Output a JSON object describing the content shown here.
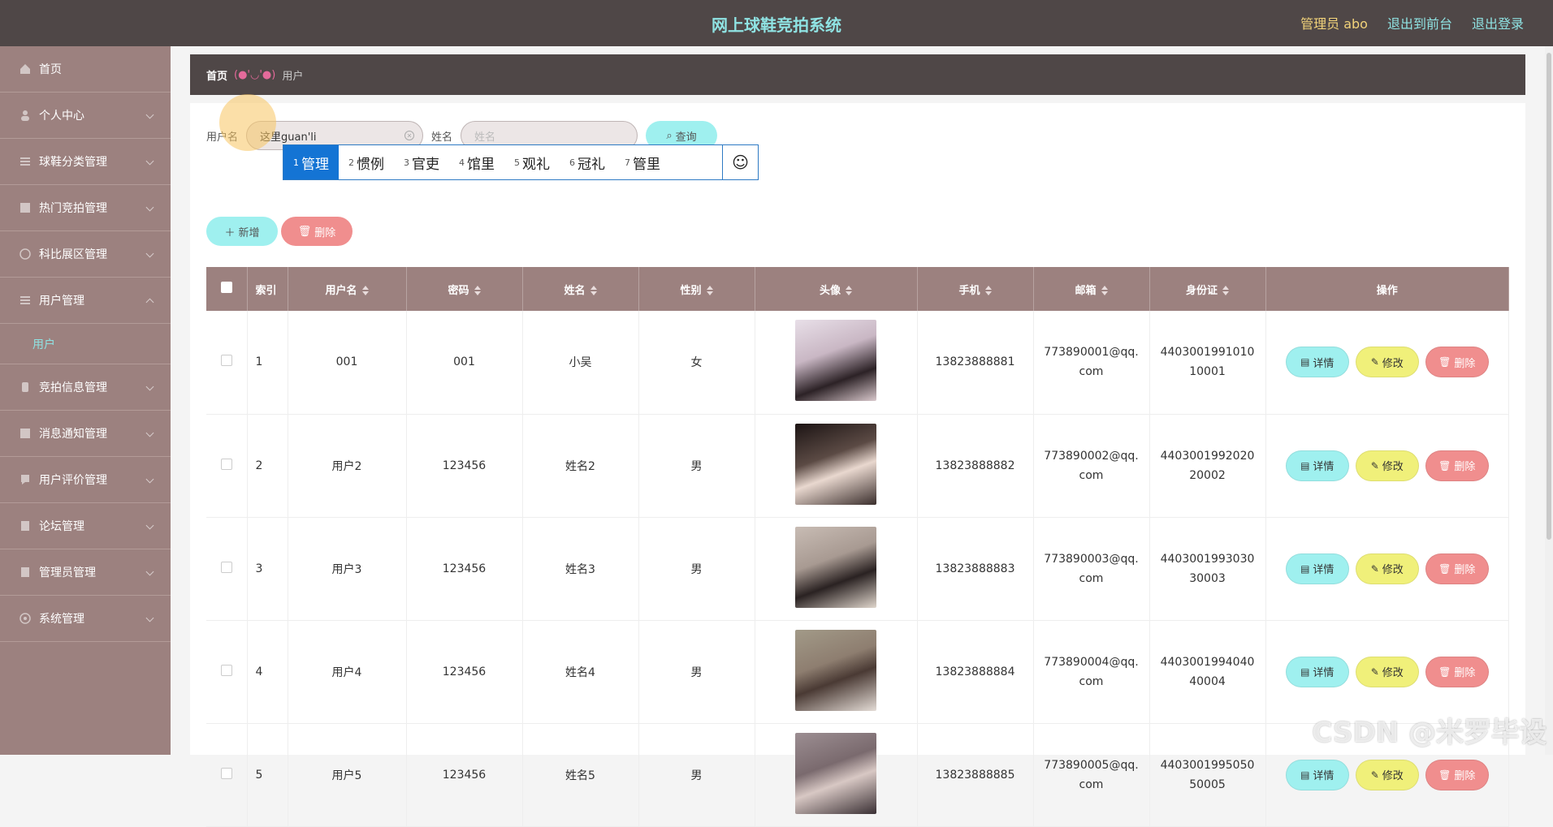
{
  "header": {
    "title": "网上球鞋竞拍系统",
    "admin_label": "管理员 abo",
    "front_link": "退出到前台",
    "logout_link": "退出登录"
  },
  "sidebar": {
    "items": [
      {
        "label": "首页",
        "icon": "home-icon"
      },
      {
        "label": "个人中心",
        "icon": "user-icon"
      },
      {
        "label": "球鞋分类管理",
        "icon": "list-icon"
      },
      {
        "label": "热门竞拍管理",
        "icon": "fire-icon"
      },
      {
        "label": "科比展区管理",
        "icon": "gallery-icon"
      },
      {
        "label": "用户管理",
        "icon": "list-icon"
      },
      {
        "label": "竞拍信息管理",
        "icon": "info-icon"
      },
      {
        "label": "消息通知管理",
        "icon": "bell-icon"
      },
      {
        "label": "用户评价管理",
        "icon": "comment-icon"
      },
      {
        "label": "论坛管理",
        "icon": "forum-icon"
      },
      {
        "label": "管理员管理",
        "icon": "admin-icon"
      },
      {
        "label": "系统管理",
        "icon": "settings-icon"
      }
    ],
    "sub_item": "用户"
  },
  "breadcrumb": {
    "home": "首页",
    "separator": "(●'◡'●)",
    "current": "用户"
  },
  "search": {
    "username_label": "用户名",
    "username_value": "这里guan'li",
    "name_label": "姓名",
    "name_placeholder": "姓名",
    "query_button": "查询"
  },
  "ime": {
    "candidates": [
      {
        "n": "1",
        "text": "管理"
      },
      {
        "n": "2",
        "text": "惯例"
      },
      {
        "n": "3",
        "text": "官吏"
      },
      {
        "n": "4",
        "text": "馆里"
      },
      {
        "n": "5",
        "text": "观礼"
      },
      {
        "n": "6",
        "text": "冠礼"
      },
      {
        "n": "7",
        "text": "管里"
      }
    ],
    "emoji": "☺"
  },
  "actions": {
    "add_label": "新增",
    "delete_label": "删除"
  },
  "table": {
    "headers": [
      "索引",
      "用户名",
      "密码",
      "姓名",
      "性别",
      "头像",
      "手机",
      "邮箱",
      "身份证",
      "操作"
    ],
    "rows": [
      {
        "index": "1",
        "username": "001",
        "password": "001",
        "name": "小吴",
        "gender": "女",
        "phone": "13823888881",
        "email": "773890001@qq.com",
        "id_card": "440300199101010001",
        "avatar_color": "#c9b7c4"
      },
      {
        "index": "2",
        "username": "用户2",
        "password": "123456",
        "name": "姓名2",
        "gender": "男",
        "phone": "13823888882",
        "email": "773890002@qq.com",
        "id_card": "440300199202020002",
        "avatar_color": "#5b4a44"
      },
      {
        "index": "3",
        "username": "用户3",
        "password": "123456",
        "name": "姓名3",
        "gender": "男",
        "phone": "13823888883",
        "email": "773890003@qq.com",
        "id_card": "440300199303030003",
        "avatar_color": "#a89a92"
      },
      {
        "index": "4",
        "username": "用户4",
        "password": "123456",
        "name": "姓名4",
        "gender": "男",
        "phone": "13823888884",
        "email": "773890004@qq.com",
        "id_card": "440300199404040004",
        "avatar_color": "#8e7e70"
      },
      {
        "index": "5",
        "username": "用户5",
        "password": "123456",
        "name": "姓名5",
        "gender": "男",
        "phone": "13823888885",
        "email": "773890005@qq.com",
        "id_card": "440300199505050005",
        "avatar_color": "#7a6a6e"
      }
    ],
    "row_actions": {
      "detail": "详情",
      "edit": "修改",
      "delete": "删除"
    }
  },
  "watermark": "CSDN @米罗毕设",
  "colors": {
    "topbar": "#4f4747",
    "sidebar": "#9c817f",
    "accent_cyan": "#9ff0ef",
    "accent_red": "#f08e8e",
    "accent_yellow": "#f0f07a"
  }
}
